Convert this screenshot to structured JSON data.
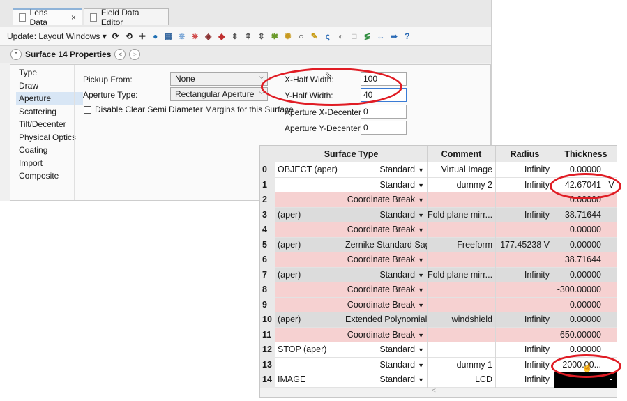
{
  "tabs": [
    {
      "label": "Lens Data",
      "close": "×"
    },
    {
      "label": "Field Data Editor"
    }
  ],
  "toolbar": {
    "update_label": "Update: Layout Windows ▾"
  },
  "propbar": {
    "title": "Surface  14 Properties",
    "collapse": "^",
    "prev": "<",
    "next": ">"
  },
  "nav": [
    "Type",
    "Draw",
    "Aperture",
    "Scattering",
    "Tilt/Decenter",
    "Physical Optics",
    "Coating",
    "Import",
    "Composite"
  ],
  "nav_selected": "Aperture",
  "aperture": {
    "pickup_label": "Pickup From:",
    "pickup_value": "None",
    "type_label": "Aperture Type:",
    "type_value": "Rectangular Aperture",
    "disable_label": "Disable Clear Semi Diameter Margins for this Surface",
    "xhalf_label": "X-Half Width:",
    "xhalf_value": "100",
    "yhalf_label": "Y-Half Width:",
    "yhalf_value": "40",
    "xdec_label": "Aperture X-Decenter:",
    "xdec_value": "0",
    "ydec_label": "Aperture Y-Decenter:",
    "ydec_value": "0"
  },
  "table": {
    "headers": {
      "surface_type": "Surface Type",
      "comment": "Comment",
      "radius": "Radius",
      "thickness": "Thickness"
    },
    "rows": [
      {
        "idx": "0",
        "name": "OBJECT (aper)",
        "type": "Standard",
        "comment": "Virtual Image",
        "radius": "Infinity",
        "thickness": "0.00000",
        "flag": "",
        "style": "white"
      },
      {
        "idx": "1",
        "name": "",
        "type": "Standard",
        "comment": "dummy 2",
        "radius": "Infinity",
        "thickness": "42.67041",
        "flag": "V",
        "style": "white"
      },
      {
        "idx": "2",
        "name": "",
        "type": "Coordinate Break",
        "comment": "",
        "radius": "",
        "thickness": "0.00000",
        "flag": "",
        "style": "cb"
      },
      {
        "idx": "3",
        "name": "(aper)",
        "type": "Standard",
        "comment": "Fold plane mirr...",
        "radius": "Infinity",
        "thickness": "-38.71644",
        "flag": "",
        "style": "gray"
      },
      {
        "idx": "4",
        "name": "",
        "type": "Coordinate Break",
        "comment": "",
        "radius": "",
        "thickness": "0.00000",
        "flag": "",
        "style": "cb"
      },
      {
        "idx": "5",
        "name": "(aper)",
        "type": "Zernike Standard Sag",
        "comment": "Freeform",
        "radius": "-177.45238  V",
        "thickness": "0.00000",
        "flag": "",
        "style": "gray"
      },
      {
        "idx": "6",
        "name": "",
        "type": "Coordinate Break",
        "comment": "",
        "radius": "",
        "thickness": "38.71644",
        "flag": "",
        "style": "cb"
      },
      {
        "idx": "7",
        "name": "(aper)",
        "type": "Standard",
        "comment": "Fold plane mirr...",
        "radius": "Infinity",
        "thickness": "0.00000",
        "flag": "",
        "style": "gray"
      },
      {
        "idx": "8",
        "name": "",
        "type": "Coordinate Break",
        "comment": "",
        "radius": "",
        "thickness": "-300.00000",
        "flag": "",
        "style": "cb"
      },
      {
        "idx": "9",
        "name": "",
        "type": "Coordinate Break",
        "comment": "",
        "radius": "",
        "thickness": "0.00000",
        "flag": "",
        "style": "cb"
      },
      {
        "idx": "10",
        "name": "(aper)",
        "type": "Extended Polynomial",
        "comment": "windshield",
        "radius": "Infinity",
        "thickness": "0.00000",
        "flag": "",
        "style": "gray"
      },
      {
        "idx": "11",
        "name": "",
        "type": "Coordinate Break",
        "comment": "",
        "radius": "",
        "thickness": "650.00000",
        "flag": "",
        "style": "cb"
      },
      {
        "idx": "12",
        "name": "STOP (aper)",
        "type": "Standard",
        "comment": "",
        "radius": "Infinity",
        "thickness": "0.00000",
        "flag": "",
        "style": "white"
      },
      {
        "idx": "13",
        "name": "",
        "type": "Standard",
        "comment": "dummy 1",
        "radius": "Infinity",
        "thickness": "-2000.00...",
        "flag": "",
        "style": "white"
      },
      {
        "idx": "14",
        "name": "IMAGE",
        "type": "Standard",
        "comment": "LCD",
        "radius": "Infinity",
        "thickness": "",
        "flag": "-",
        "style": "white"
      }
    ],
    "scroll_arrow": "<"
  },
  "colors": {
    "highlight": "#e01c24",
    "coordinate_break": "#f6d1d1",
    "gray_row": "#dcdcdc"
  }
}
